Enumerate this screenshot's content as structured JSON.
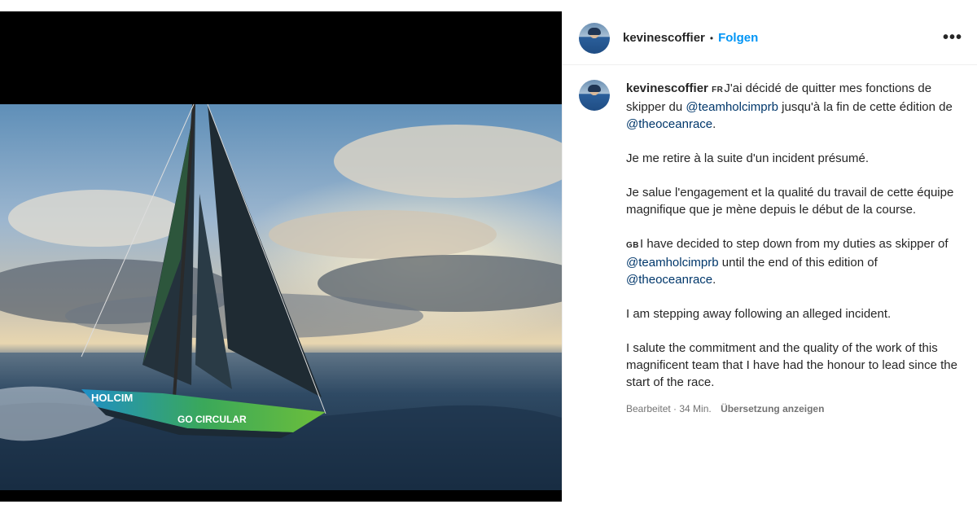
{
  "post": {
    "username": "kevinescoffier",
    "separator": "•",
    "follow_label": "Folgen",
    "more_label": "•••"
  },
  "caption": {
    "username": "kevinescoffier",
    "fr_flag": "FR",
    "p1_a": "J'ai décidé de quitter mes fonctions de skipper du ",
    "mention_team": "@teamholcimprb",
    "p1_b": " jusqu'à la fin de cette édition de ",
    "mention_race": "@theoceanrace",
    "p1_c": ".",
    "p2": "Je me retire à la suite d'un incident présumé.",
    "p3": "Je salue l'engagement et la qualité du travail de cette équipe magnifique que je mène depuis le début de la course.",
    "gb_flag": "GB",
    "p4_a": "I have decided to step down from my duties as skipper of ",
    "p4_mention_team": "@teamholcimprb",
    "p4_b": " until the end of this edition of ",
    "p4_mention_race": "@theoceanrace",
    "p4_c": ".",
    "p5": "I am stepping away following an alleged incident.",
    "p6": "I salute the commitment and the quality of the work of this magnificent team that I have had the honour to lead since the start of the race."
  },
  "meta": {
    "edited": "Bearbeitet · 34 Min.",
    "translate": "Übersetzung anzeigen"
  },
  "photo": {
    "hull_text_1": "HOLCIM",
    "hull_text_2": "GO CIRCULAR"
  }
}
